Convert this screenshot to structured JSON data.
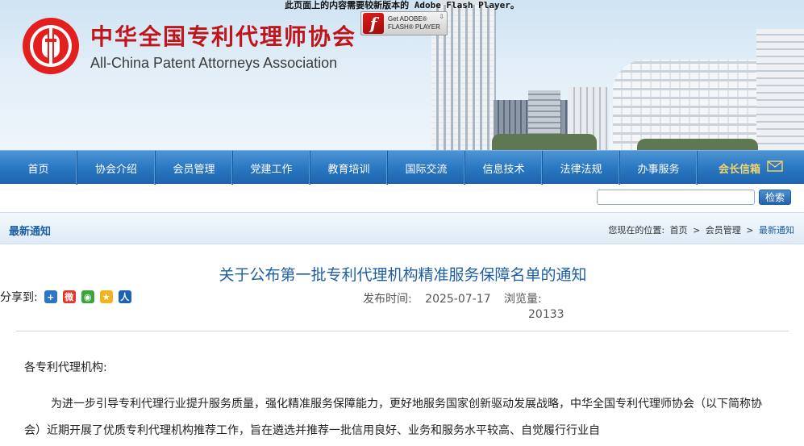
{
  "flash": {
    "notice": "此页面上的内容需要较新版本的 Adobe Flash Player。",
    "badge_get": "Get ADOBE®",
    "badge_product": "FLASH® PLAYER"
  },
  "header": {
    "title_cn": "中华全国专利代理师协会",
    "title_en": "All-China Patent Attorneys Association"
  },
  "nav": {
    "items": [
      {
        "label": "首页"
      },
      {
        "label": "协会介绍"
      },
      {
        "label": "会员管理"
      },
      {
        "label": "党建工作"
      },
      {
        "label": "教育培训"
      },
      {
        "label": "国际交流"
      },
      {
        "label": "信息技术"
      },
      {
        "label": "法律法规"
      },
      {
        "label": "办事服务"
      },
      {
        "label": "会长信箱"
      }
    ]
  },
  "search": {
    "value": "",
    "button_label": "检索"
  },
  "section": {
    "title": "最新通知",
    "breadcrumb_prefix": "您现在的位置:",
    "crumbs": [
      "首页",
      "会员管理",
      "最新通知"
    ],
    "separator": ">"
  },
  "article": {
    "title": "关于公布第一批专利代理机构精准服务保障名单的通知",
    "share_label": "分享到:",
    "publish_label": "发布时间:",
    "publish_date": "2025-07-17",
    "views_label": "浏览量:",
    "views": "20133",
    "greeting": "各专利代理机构:",
    "paragraph1": "为进一步引导专利代理行业提升服务质量，强化精准服务保障能力，更好地服务国家创新驱动发展战略，中华全国专利代理师协会（以下简称协会）近期开展了优质专利代理机构推荐工作，旨在遴选并推荐一批信用良好、业务和服务水平较高、自觉履行行业自"
  },
  "share_icons": [
    {
      "name": "share-more-icon",
      "glyph": "+",
      "color": "#2a77c8"
    },
    {
      "name": "weibo-icon",
      "glyph": "微",
      "color": "#e0392b"
    },
    {
      "name": "wechat-icon",
      "glyph": "◉",
      "color": "#3aa63a"
    },
    {
      "name": "qzone-icon",
      "glyph": "★",
      "color": "#f2b320"
    },
    {
      "name": "renren-icon",
      "glyph": "人",
      "color": "#1d63b5"
    }
  ]
}
